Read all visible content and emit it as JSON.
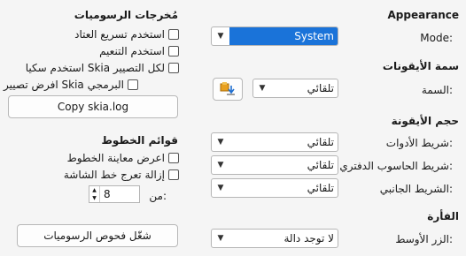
{
  "appearance": {
    "heading": "Appearance",
    "mode_label": "Mode:",
    "mode_value": "System"
  },
  "icon_theme": {
    "heading": "سمة الأيقونات",
    "theme_label": "السمة:",
    "theme_value": "تلقائي"
  },
  "icon_size": {
    "heading": "حجم الأيقونة",
    "toolbar_label": "شريط الأدوات:",
    "toolbar_value": "تلقائي",
    "notebookbar_label": "شريط الحاسوب الدفتري:",
    "notebookbar_value": "تلقائي",
    "sidebar_label": "الشريط الجانبي:",
    "sidebar_value": "تلقائي"
  },
  "mouse": {
    "heading": "الفأرة",
    "middle_button_label": "الزر الأوسط:",
    "middle_button_value": "لا توجد دالة"
  },
  "graphics_output": {
    "heading": "مُخرجات الرسوميات",
    "hw_accel": "استخدم تسريع العتاد",
    "antialias": "استخدم التنعيم",
    "skia_all": "استخدم سكيا Skia لكل التصيير",
    "skia_software": "افرض تصيير  سكيا Skia البرمجي",
    "copy_button": "Copy skia.log"
  },
  "font_lists": {
    "heading": "قوائم الخطوط",
    "preview_fonts": "اعرض معاينة الخطوط",
    "screen_aa": "إزالة تعرج خط الشاشة",
    "from_label": "من:",
    "from_value": "8"
  },
  "run_graphics_tests": "شغّل فحوص الرسوميات",
  "icons": {
    "theme_picker": "icon-theme-extension-icon",
    "combo_arrow": "chevron-down-icon"
  },
  "colors": {
    "selection": "#1a73d9"
  }
}
